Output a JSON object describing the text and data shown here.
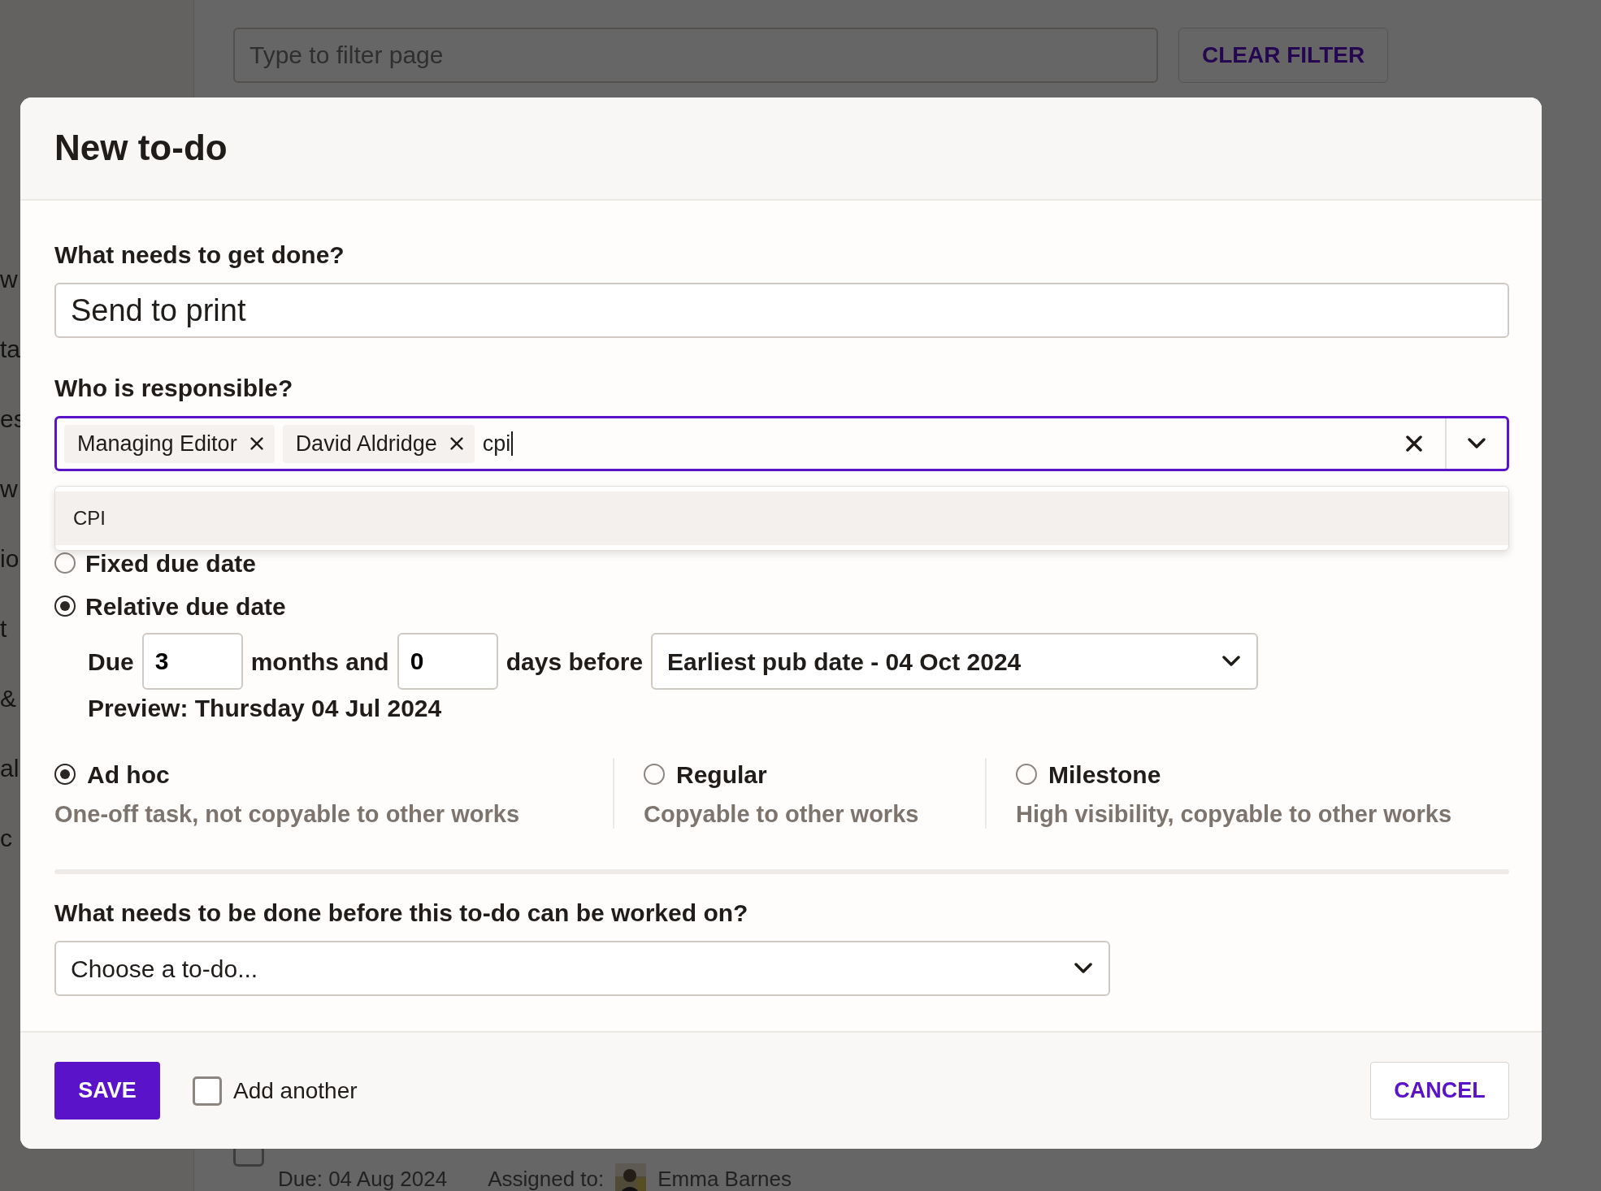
{
  "background": {
    "sidebar": {
      "items": [
        {
          "label": "w"
        },
        {
          "label": "ta"
        },
        {
          "label": "es"
        },
        {
          "label": "w"
        },
        {
          "label": "io"
        },
        {
          "label": "t"
        },
        {
          "label": "&"
        },
        {
          "label": "al"
        },
        {
          "label": "c"
        }
      ]
    },
    "filter": {
      "placeholder": "Type to filter page"
    },
    "clear_button": "CLEAR FILTER",
    "task": {
      "checked": false,
      "due": "Due: 04 Aug 2024",
      "assigned_label": "Assigned to:",
      "assignee": "Emma Barnes"
    }
  },
  "modal": {
    "title": "New to-do",
    "task_label": "What needs to get done?",
    "task_value": "Send to print",
    "responsible_label": "Who is responsible?",
    "chips": [
      {
        "label": "Managing Editor"
      },
      {
        "label": "David Aldridge"
      }
    ],
    "search_text": "cpi",
    "options": [
      {
        "label": "CPI",
        "highlighted": true
      }
    ],
    "due_modes": [
      {
        "label": "Fixed due date",
        "selected": false
      },
      {
        "label": "Relative due date",
        "selected": true
      }
    ],
    "relative": {
      "due_label": "Due",
      "months": "3",
      "months_label": "months and",
      "days": "0",
      "days_label": "days before",
      "anchor": "Earliest pub date - 04 Oct 2024",
      "preview": "Preview: Thursday 04 Jul 2024"
    },
    "types": [
      {
        "label": "Ad hoc",
        "description": "One-off task, not copyable to other works",
        "selected": true
      },
      {
        "label": "Regular",
        "description": "Copyable to other works",
        "selected": false
      },
      {
        "label": "Milestone",
        "description": "High visibility, copyable to other works",
        "selected": false
      }
    ],
    "dependency_label": "What needs to be done before this to-do can be worked on?",
    "dependency_select": "Choose a to-do...",
    "save": "SAVE",
    "add_another": {
      "label": "Add another",
      "checked": false
    },
    "cancel": "CANCEL"
  }
}
